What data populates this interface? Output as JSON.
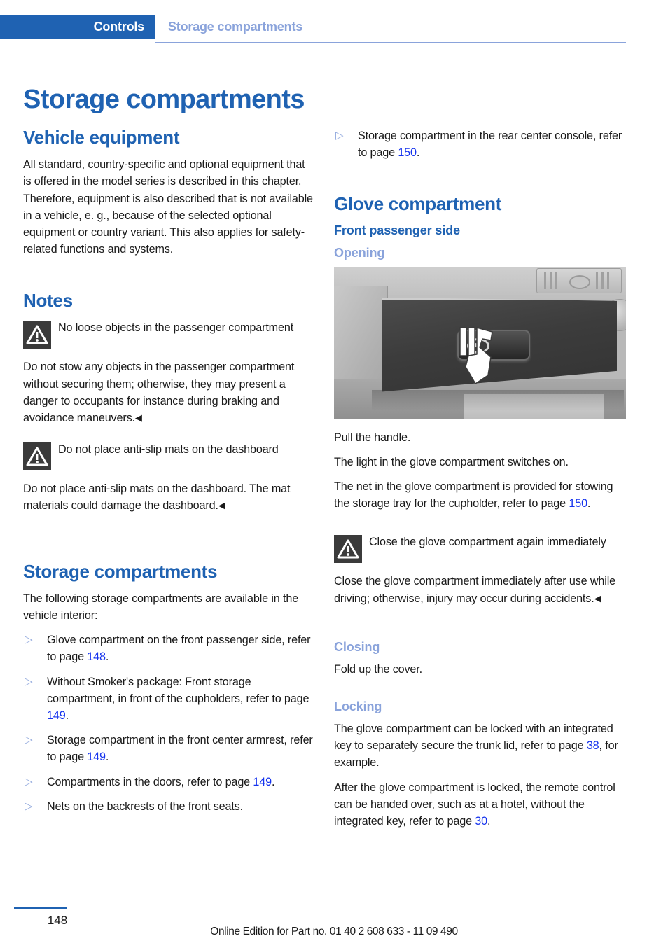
{
  "header": {
    "tab_label": "Controls",
    "chapter_label": "Storage compartments"
  },
  "page_title": "Storage compartments",
  "colors": {
    "brand_blue": "#1f62b2",
    "light_blue": "#8aa3db",
    "link_blue": "#1533ee",
    "warning_icon_bg": "#3b3b3b"
  },
  "left_column": {
    "vehicle_equipment": {
      "heading": "Vehicle equipment",
      "paragraph": "All standard, country-specific and optional equipment that is offered in the model series is described in this chapter. Therefore, equipment is also described that is not available in a vehicle, e. g., because of the selected optional equipment or country variant. This also applies for safety-related functions and systems."
    },
    "notes": {
      "heading": "Notes",
      "warning_1": {
        "icon": "warning-triangle-icon",
        "title": "No loose objects in the passenger compartment",
        "body": "Do not stow any objects in the passenger compartment without securing them; otherwise, they may present a danger to occupants for instance during braking and avoidance maneuvers.",
        "endmark": "◀"
      },
      "warning_2": {
        "icon": "warning-triangle-icon",
        "title": "Do not place anti-slip mats on the dashboard",
        "body": "Do not place anti-slip mats on the dashboard. The mat materials could damage the dashboard.",
        "endmark": "◀"
      }
    },
    "storage_compartments": {
      "heading": "Storage compartments",
      "intro": "The following storage compartments are available in the vehicle interior:",
      "bullet_glyph": "▷",
      "items": [
        {
          "text_before": "Glove compartment on the front passenger side, refer to page ",
          "page": "148",
          "text_after": "."
        },
        {
          "text_before": "Without Smoker's package: Front storage compartment, in front of the cupholders, refer to page ",
          "page": "149",
          "text_after": "."
        },
        {
          "text_before": "Storage compartment in the front center armrest, refer to page ",
          "page": "149",
          "text_after": "."
        },
        {
          "text_before": "Compartments in the doors, refer to page ",
          "page": "149",
          "text_after": "."
        },
        {
          "text_before": "Nets on the backrests of the front seats.",
          "page": "",
          "text_after": ""
        }
      ]
    }
  },
  "right_column": {
    "continued_bullet": {
      "bullet_glyph": "▷",
      "text_before": "Storage compartment in the rear center console, refer to page ",
      "page": "150",
      "text_after": "."
    },
    "glove_compartment": {
      "heading": "Glove compartment",
      "subheading": "Front passenger side",
      "opening": {
        "heading": "Opening",
        "figure_caption": "glove-compartment-illustration",
        "paragraph_1": "Pull the handle.",
        "paragraph_2": "The light in the glove compartment switches on.",
        "paragraph_3_before": "The net in the glove compartment is provided for stowing the storage tray for the cupholder, refer to page ",
        "paragraph_3_page": "150",
        "paragraph_3_after": ".",
        "warning": {
          "icon": "warning-triangle-icon",
          "title": "Close the glove compartment again immediately",
          "body": "Close the glove compartment immediately after use while driving; otherwise, injury may occur during accidents.",
          "endmark": "◀"
        }
      },
      "closing": {
        "heading": "Closing",
        "paragraph": "Fold up the cover."
      },
      "locking": {
        "heading": "Locking",
        "paragraph_1_before": "The glove compartment can be locked with an integrated key to separately secure the trunk lid, refer to page ",
        "paragraph_1_page": "38",
        "paragraph_1_after": ", for example.",
        "paragraph_2_before": "After the glove compartment is locked, the remote control can be handed over, such as at a hotel, without the integrated key, refer to page ",
        "paragraph_2_page": "30",
        "paragraph_2_after": "."
      }
    }
  },
  "footer": {
    "page_number": "148",
    "note": "Online Edition for Part no. 01 40 2 608 633 - 11 09 490"
  }
}
